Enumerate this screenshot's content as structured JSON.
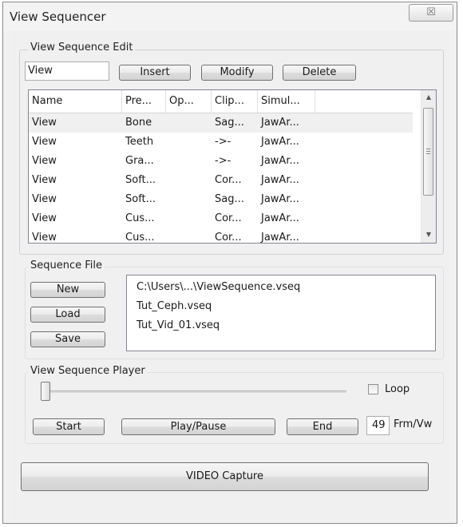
{
  "window": {
    "title": "View Sequencer",
    "close_label": "☒"
  },
  "edit_group": {
    "label": "View Sequence Edit",
    "name_input_value": "View",
    "insert_label": "Insert",
    "modify_label": "Modify",
    "delete_label": "Delete"
  },
  "list": {
    "columns": [
      "Name",
      "Pre...",
      "Op...",
      "Clip...",
      "Simul..."
    ],
    "rows": [
      [
        "View",
        "Bone",
        "",
        "Sag...",
        "JawAr..."
      ],
      [
        "View",
        "Teeth",
        "",
        "->-",
        "JawAr..."
      ],
      [
        "View",
        "Gra...",
        "",
        "->-",
        "JawAr..."
      ],
      [
        "View",
        "Soft...",
        "",
        "Cor...",
        "JawAr..."
      ],
      [
        "View",
        "Soft...",
        "",
        "Sag...",
        "JawAr..."
      ],
      [
        "View",
        "Cus...",
        "",
        "Cor...",
        "JawAr..."
      ],
      [
        "View",
        "Cus...",
        "",
        "Cor...",
        "JawAr..."
      ]
    ]
  },
  "file_group": {
    "label": "Sequence File",
    "new_label": "New",
    "load_label": "Load",
    "save_label": "Save",
    "files": [
      "C:\\Users\\...\\ViewSequence.vseq",
      "Tut_Ceph.vseq",
      "Tut_Vid_01.vseq"
    ]
  },
  "player_group": {
    "label": "View Sequence Player",
    "loop_label": "Loop",
    "start_label": "Start",
    "playpause_label": "Play/Pause",
    "end_label": "End",
    "frames_value": "49",
    "frames_unit": "Frm/Vw"
  },
  "capture_label": "VIDEO Capture"
}
